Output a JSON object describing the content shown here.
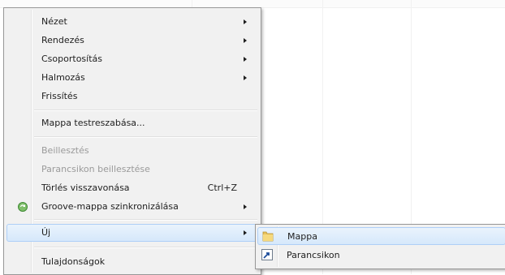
{
  "context_menu": {
    "items": [
      {
        "label": "Nézet",
        "submenu": true
      },
      {
        "label": "Rendezés",
        "submenu": true
      },
      {
        "label": "Csoportosítás",
        "submenu": true
      },
      {
        "label": "Halmozás",
        "submenu": true
      },
      {
        "label": "Frissítés"
      },
      {
        "label": "Mappa testreszabása..."
      },
      {
        "label": "Beillesztés",
        "disabled": true
      },
      {
        "label": "Parancsikon beillesztése",
        "disabled": true
      },
      {
        "label": "Törlés visszavonása",
        "shortcut": "Ctrl+Z"
      },
      {
        "label": "Groove-mappa szinkronizálása",
        "submenu": true,
        "icon": "groove-sync-icon"
      },
      {
        "label": "Új",
        "submenu": true,
        "highlighted": true
      },
      {
        "label": "Tulajdonságok"
      }
    ]
  },
  "submenu_new": {
    "items": [
      {
        "label": "Mappa",
        "icon": "folder-icon",
        "highlighted": true
      },
      {
        "label": "Parancsikon",
        "icon": "shortcut-icon"
      }
    ]
  },
  "colors": {
    "menu_background": "#f1f1f1",
    "menu_border": "#979797",
    "highlight_border": "#aecff7",
    "disabled_text": "#9a9a9a"
  }
}
